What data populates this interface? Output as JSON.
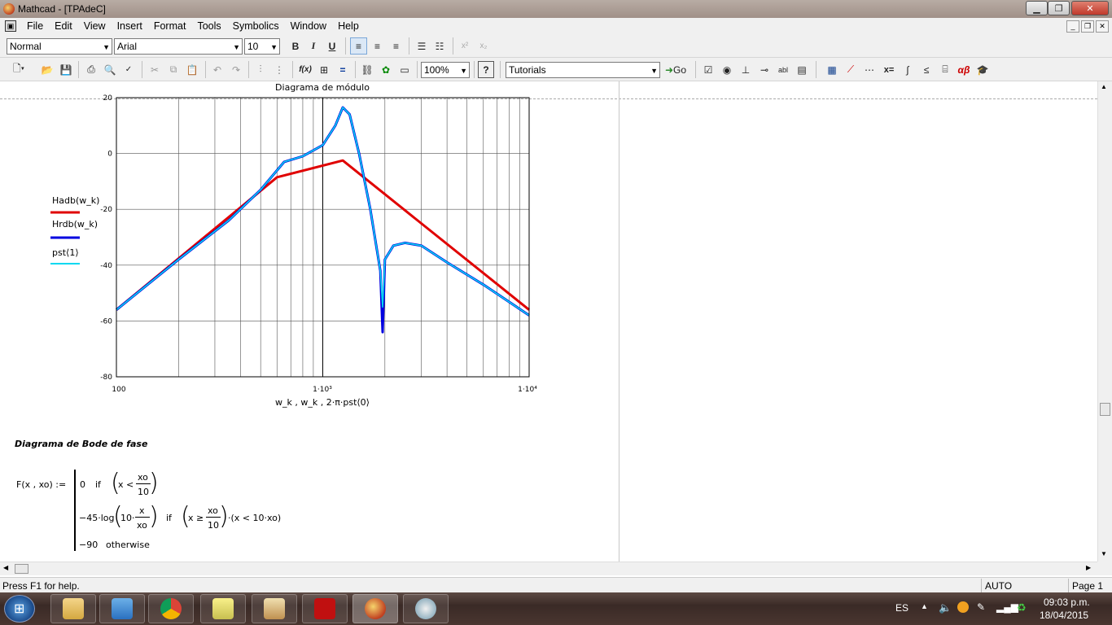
{
  "window": {
    "title": "Mathcad - [TPAdeC]"
  },
  "menu": [
    "File",
    "Edit",
    "View",
    "Insert",
    "Format",
    "Tools",
    "Symbolics",
    "Window",
    "Help"
  ],
  "format_toolbar": {
    "style": "Normal",
    "font": "Arial",
    "size": "10",
    "bold": "B",
    "italic": "I",
    "underline": "U",
    "superscript": "x²",
    "subscript": "x₂"
  },
  "standard_toolbar": {
    "zoom": "100%",
    "resource": "Tutorials",
    "go": "Go",
    "fx": "f(x)",
    "xeq": "x=",
    "alphabeta": "αβ"
  },
  "chart_data": {
    "type": "line",
    "title": "Diagrama de módulo",
    "xscale": "log",
    "xlim": [
      100,
      10000
    ],
    "ylim": [
      -80,
      20
    ],
    "yticks": [
      20,
      0,
      -20,
      -40,
      -60,
      -80
    ],
    "xtick_labels": [
      "100",
      "1·10³",
      "1·10⁴"
    ],
    "xlabel": "w_k , w_k , 2·π·pst⟨0⟩",
    "grid": true,
    "legend_position": "left",
    "series": [
      {
        "name": "Hadb(w_k)",
        "color": "#e00000",
        "x": [
          100,
          600,
          1250,
          10000
        ],
        "y": [
          -56,
          -8.5,
          -2.5,
          -56
        ]
      },
      {
        "name": "Hrdb(w_k)",
        "color": "#0000e0",
        "x": [
          100,
          200,
          350,
          500,
          650,
          800,
          1000,
          1150,
          1250,
          1350,
          1500,
          1700,
          1900,
          1950,
          2000,
          2200,
          2500,
          3000,
          4000,
          6000,
          10000
        ],
        "y": [
          -56,
          -38,
          -24,
          -13,
          -3,
          -1,
          3,
          10,
          16.5,
          14,
          0,
          -20,
          -42,
          -64,
          -38,
          -33,
          -32,
          -33,
          -39,
          -47,
          -58
        ]
      },
      {
        "name": "pst⟨1⟩",
        "color": "#00d8f0",
        "x": [
          100,
          200,
          350,
          500,
          650,
          800,
          1000,
          1150,
          1250,
          1350,
          1500,
          1700,
          1900,
          1950,
          2000,
          2200,
          2500,
          3000,
          4000,
          6000,
          10000
        ],
        "y": [
          -56,
          -38,
          -24,
          -13,
          -3,
          -1,
          3,
          10,
          16.5,
          14,
          0,
          -20,
          -42,
          -55,
          -38,
          -33,
          -32,
          -33,
          -39,
          -47,
          -58
        ]
      }
    ]
  },
  "section": {
    "heading": "Diagrama de Bode de fase"
  },
  "formula": {
    "lhs": "F(x , xo) :=",
    "case1_val": "0",
    "case1_if": "if",
    "case1_cond": "x <",
    "case1_num": "xo",
    "case1_den": "10",
    "case2_val": "−45·log",
    "case2_arg": "10·",
    "case2_num": "x",
    "case2_den": "xo",
    "case2_if": "if",
    "case2_cond": "x ≥",
    "case2_num2": "xo",
    "case2_den2": "10",
    "case2_tail": "·(x < 10·xo)",
    "case3_val": "−90",
    "case3_label": "otherwise"
  },
  "status": {
    "help": "Press F1 for help.",
    "mode": "AUTO",
    "page": "Page 1"
  },
  "tray": {
    "lang": "ES",
    "time": "09:03 p.m.",
    "date": "18/04/2015"
  }
}
